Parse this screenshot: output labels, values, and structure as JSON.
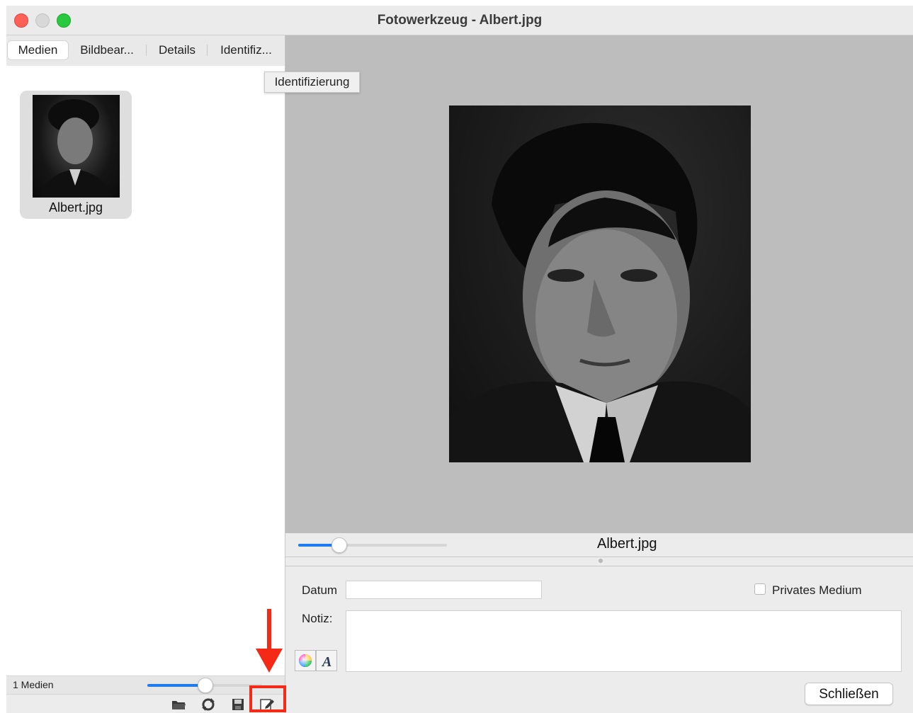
{
  "window": {
    "title": "Fotowerkzeug - Albert.jpg"
  },
  "tabs": [
    {
      "label": "Medien",
      "active": true
    },
    {
      "label": "Bildbear..."
    },
    {
      "label": "Details"
    },
    {
      "label": "Identifiz..."
    }
  ],
  "tooltip": "Identifizierung",
  "media_item": {
    "filename": "Albert.jpg"
  },
  "left_status": {
    "count": "1 Medien",
    "zoom_fraction": 0.5
  },
  "toolbar_icons": [
    "folder-icon",
    "refresh-icon",
    "save-icon",
    "edit-icon"
  ],
  "viewer": {
    "filename": "Albert.jpg",
    "zoom_fraction": 0.27
  },
  "form": {
    "date_label": "Datum",
    "date_value": "",
    "private_label": "Privates Medium",
    "private_checked": false,
    "note_label": "Notiz:",
    "note_value": "",
    "close_button": "Schließen"
  },
  "colors": {
    "accent": "#1f7bf2",
    "annotation": "#f42a17"
  }
}
